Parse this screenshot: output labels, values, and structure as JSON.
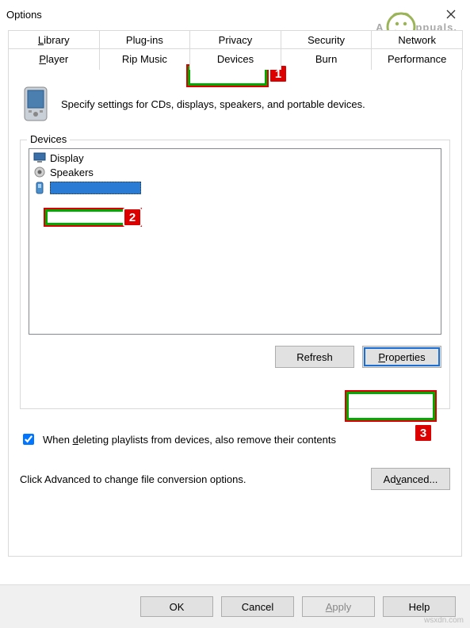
{
  "window": {
    "title": "Options"
  },
  "tabs": {
    "row1": [
      {
        "label": "Library",
        "u": "L",
        "suffix": "ibrary"
      },
      {
        "label": "Plug-ins",
        "u": "",
        "suffix": "Plug-ins"
      },
      {
        "label": "Privacy",
        "u": "",
        "suffix": "Privacy"
      },
      {
        "label": "Security",
        "u": "",
        "suffix": "Security"
      },
      {
        "label": "Network",
        "u": "",
        "suffix": "Network"
      }
    ],
    "row2": [
      {
        "label": "Player",
        "u": "P",
        "suffix": "layer"
      },
      {
        "label": "Rip Music",
        "u": "",
        "suffix": "Rip Music"
      },
      {
        "label": "Devices",
        "u": "",
        "suffix": "Devices",
        "active": true
      },
      {
        "label": "Burn",
        "u": "",
        "suffix": "Burn"
      },
      {
        "label": "Performance",
        "u": "",
        "suffix": "Performance"
      }
    ]
  },
  "content": {
    "description": "Specify settings for CDs, displays, speakers, and portable devices.",
    "fieldset_label": "Devices",
    "devices": [
      {
        "name": "Display",
        "icon": "monitor"
      },
      {
        "name": "Speakers",
        "icon": "speaker"
      },
      {
        "name": "",
        "icon": "portable",
        "selected": true
      }
    ],
    "refresh_btn": "Refresh",
    "properties_btn": "Properties",
    "checkbox_label_before": "When ",
    "checkbox_underline": "d",
    "checkbox_label_after": "eleting playlists from devices, also remove their contents",
    "checkbox_checked": true,
    "advanced_text": "Click Advanced to change file conversion options.",
    "advanced_btn_before": "Ad",
    "advanced_btn_u": "v",
    "advanced_btn_after": "anced..."
  },
  "footer": {
    "ok": "OK",
    "cancel": "Cancel",
    "apply_before": "",
    "apply_u": "A",
    "apply_after": "pply",
    "help": "Help"
  },
  "annotations": {
    "n1": "1",
    "n2": "2",
    "n3": "3"
  },
  "watermark": {
    "text_before": "A",
    "text_after": "ppuals."
  },
  "attribution": "wsxdn.com"
}
